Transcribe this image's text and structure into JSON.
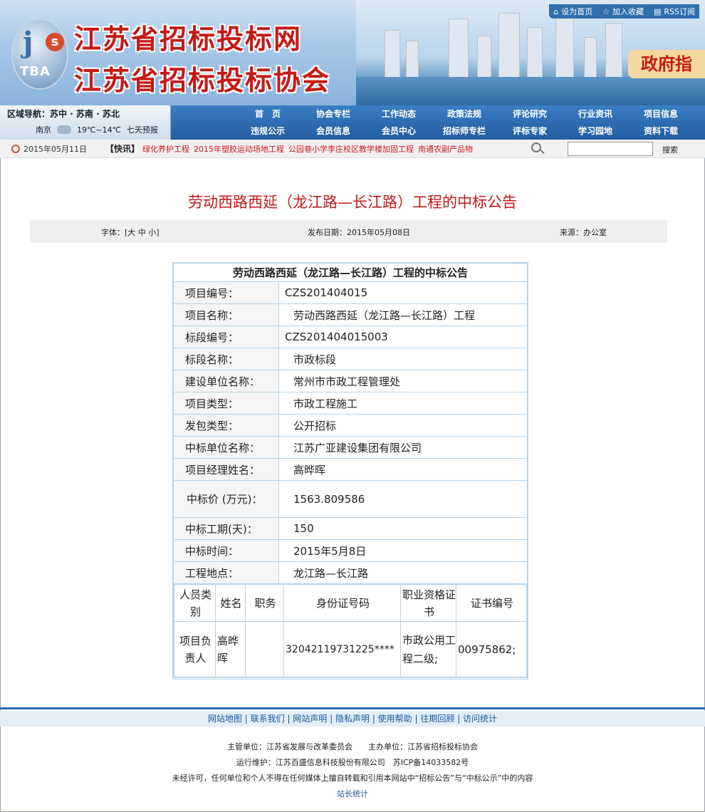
{
  "header": {
    "top_links": [
      "设为首页",
      "加入收藏",
      "RSS订阅"
    ],
    "site_name_1": "江苏省招标投标网",
    "site_name_2": "江苏省招标投标协会",
    "logo_text": "TBA",
    "logo_js": "j",
    "logo_s": "s",
    "gov_badge": "政府指"
  },
  "nav": {
    "region_label": "区域导航：",
    "regions": "苏中 · 苏南 · 苏北",
    "city": "南京",
    "temp": "19℃~14℃",
    "forecast": "七天预报",
    "menu": [
      "首　页",
      "协会专栏",
      "工作动态",
      "政策法规",
      "评论研究",
      "行业资讯",
      "项目信息",
      "违规公示",
      "会员信息",
      "会员中心",
      "招标师专栏",
      "评标专家",
      "学习园地",
      "资料下载"
    ]
  },
  "ticker": {
    "date": "2015年05月11日",
    "label": "【快讯】",
    "items": [
      "绿化养护工程",
      "2015年塑胶运动场地工程",
      "公园巷小学李庄校区教学楼加固工程",
      "南通农副产品物"
    ],
    "search_btn": "搜索"
  },
  "article": {
    "title": "劳动西路西延（龙江路—长江路）工程的中标公告",
    "font_label": "字体：[大 中 小]",
    "pub_date": "发布日期：2015年05月08日",
    "source": "来源：办公室"
  },
  "table": {
    "caption": "劳动西路西延（龙江路—长江路）工程的中标公告",
    "rows": [
      [
        "项目编号：",
        "CZS201404015"
      ],
      [
        "项目名称：",
        "劳动西路西延（龙江路—长江路）工程"
      ],
      [
        "标段编号：",
        "CZS201404015003"
      ],
      [
        "标段名称：",
        "市政标段"
      ],
      [
        "建设单位名称：",
        "常州市市政工程管理处"
      ],
      [
        "项目类型：",
        "市政工程施工"
      ],
      [
        "发包类型：",
        "公开招标"
      ],
      [
        "中标单位名称：",
        "江苏广亚建设集团有限公司"
      ],
      [
        "项目经理姓名：",
        "高晔晖"
      ],
      [
        "中标价 (万元)：",
        "1563.809586"
      ],
      [
        "中标工期(天)：",
        "150"
      ],
      [
        "中标时间：",
        "2015年5月8日"
      ],
      [
        "工程地点：",
        "龙江路—长江路"
      ]
    ],
    "personnel_headers": [
      "人员类别",
      "姓名",
      "职务",
      "身份证号码",
      "职业资格证书",
      "证书编号"
    ],
    "personnel_row": [
      "项目负责人",
      "高晔晖",
      "",
      "32042119731225****",
      "市政公用工程二级;",
      "00975862;"
    ]
  },
  "footer": {
    "links": [
      "网站地图",
      "联系我们",
      "网站声明",
      "隐私声明",
      "使用帮助",
      "往期回顾",
      "访问统计"
    ],
    "line1": "主管单位：江苏省发展与改革委员会　　主办单位：江苏省招标投标协会",
    "line2": "运行维护：江苏百盛信息科技股份有限公司　苏ICP备14033582号",
    "line3": "未经许可，任何单位和个人不得在任何媒体上擅自转载和引用本网站中“招标公告”与“中标公示”中的内容",
    "stat": "站长统计"
  }
}
